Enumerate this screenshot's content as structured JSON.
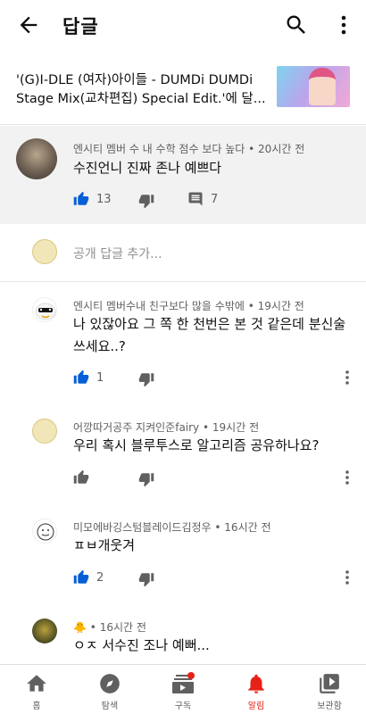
{
  "appbar": {
    "title": "답글",
    "back_icon": "arrow-left-icon",
    "search_icon": "search-icon",
    "more_icon": "more-vert-icon"
  },
  "video": {
    "title": "'(G)I-DLE (여자)아이들 - DUMDi DUMDi Stage Mix(교차편집) Special Edit.'에 달..."
  },
  "parent_comment": {
    "author": "엔시티 멤버 수 내 수학 점수 보다 높다",
    "time": "20시간 전",
    "text": "수진언니 진짜 존나 예쁘다",
    "likes": "13",
    "replies": "7"
  },
  "add_reply": {
    "placeholder": "공개 답글 추가..."
  },
  "replies": [
    {
      "author": "엔시티 멤버수내 친구보다 많을 수밖에",
      "time": "19시간 전",
      "text_line1": "나 있잖아요 그 쪽 한 천번은 본 것 같은데 분신술",
      "text_line2": "쓰세요..?",
      "likes": "1"
    },
    {
      "author": "어깡따거공주 지켜인준fairy",
      "time": "19시간 전",
      "text_line1": "우리 혹시 블루투스로 알고리즘 공유하나요?",
      "likes": ""
    },
    {
      "author": "미모에바깅스텀블레이드김정우",
      "time": "16시간 전",
      "text_line1": "ㅍㅂ개웃겨",
      "likes": "2"
    },
    {
      "author": "🐥",
      "time": "16시간 전",
      "text_line1": "ㅇㅈ 서수진 조나 예뻐..."
    }
  ],
  "separator": "•",
  "nav": [
    {
      "label": "홈",
      "icon": "home-icon"
    },
    {
      "label": "탐색",
      "icon": "compass-icon"
    },
    {
      "label": "구독",
      "icon": "subscriptions-icon"
    },
    {
      "label": "알림",
      "icon": "bell-icon",
      "active": true
    },
    {
      "label": "보관함",
      "icon": "library-icon"
    }
  ],
  "colors": {
    "accent": "#e62117",
    "like_blue": "#065fd4",
    "icon_gray": "#606060"
  }
}
